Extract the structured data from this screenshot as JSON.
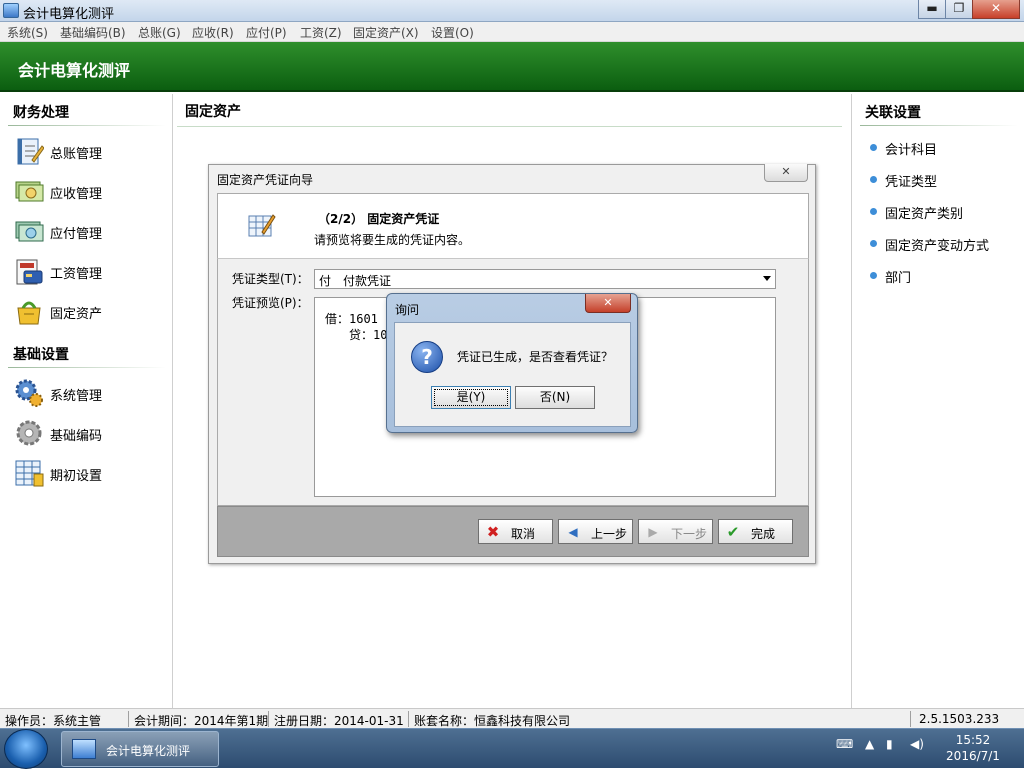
{
  "window": {
    "title": "会计电算化测评",
    "controls": {
      "minimize": "▬",
      "restore": "❐",
      "close": "✕"
    }
  },
  "menu": [
    "系统(S)",
    "基础编码(B)",
    "总账(G)",
    "应收(R)",
    "应付(P)",
    "工资(Z)",
    "固定资产(X)",
    "设置(O)"
  ],
  "banner": {
    "title": "会计电算化测评"
  },
  "left": {
    "finance_title": "财务处理",
    "finance_items": [
      {
        "label": "总账管理",
        "icon": "ledger-icon"
      },
      {
        "label": "应收管理",
        "icon": "receivable-icon"
      },
      {
        "label": "应付管理",
        "icon": "payable-icon"
      },
      {
        "label": "工资管理",
        "icon": "salary-icon"
      },
      {
        "label": "固定资产",
        "icon": "fixed-asset-icon"
      }
    ],
    "basic_title": "基础设置",
    "basic_items": [
      {
        "label": "系统管理",
        "icon": "system-gear-icon"
      },
      {
        "label": "基础编码",
        "icon": "basic-code-gear-icon"
      },
      {
        "label": "期初设置",
        "icon": "opening-settings-icon"
      }
    ]
  },
  "center": {
    "title": "固定资产"
  },
  "right": {
    "title": "关联设置",
    "items": [
      "会计科目",
      "凭证类型",
      "固定资产类别",
      "固定资产变动方式",
      "部门"
    ]
  },
  "wizard": {
    "title": "固定资产凭证向导",
    "close": "✕",
    "step_title": "（2/2） 固定资产凭证",
    "step_desc": "请预览将要生成的凭证内容。",
    "voucher_type_label": "凭证类型(T)：",
    "voucher_type_value": "付　付款凭证",
    "preview_label": "凭证预览(P)：",
    "preview_line1": "借：1601 固",
    "preview_line2": "贷：100",
    "buttons": {
      "cancel": "取消",
      "prev": "上一步",
      "next": "下一步",
      "finish": "完成"
    }
  },
  "dialog": {
    "title": "询问",
    "close": "✕",
    "message": "凭证已生成，是否查看凭证？",
    "yes": "是(Y)",
    "no": "否(N)"
  },
  "status": {
    "operator": "操作员：系统主管",
    "period": "会计期间：2014年第1期",
    "reg_date": "注册日期：2014-01-31",
    "account_set": "账套名称：恒鑫科技有限公司",
    "version": "2.5.1503.233"
  },
  "taskbar": {
    "app_label": "会计电算化测评",
    "time": "15:52",
    "date": "2016/7/1"
  }
}
